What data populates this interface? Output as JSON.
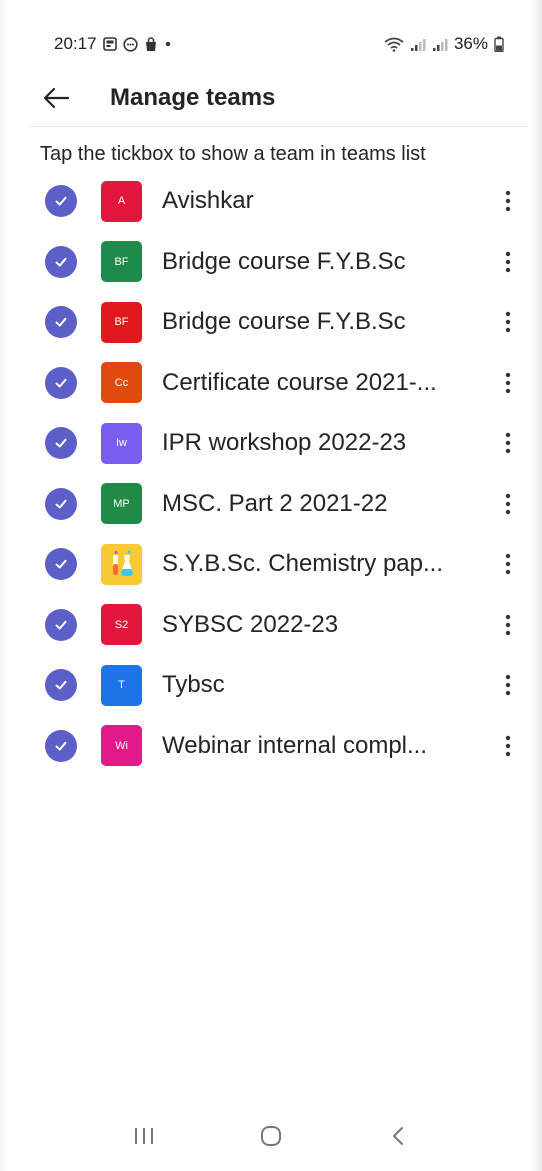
{
  "status": {
    "time": "20:17",
    "battery": "36%"
  },
  "header": {
    "title": "Manage teams"
  },
  "hint": "Tap the tickbox to show a team in teams list",
  "teams": [
    {
      "name": "Avishkar",
      "initials": "A",
      "color": "#e3173d",
      "checked": true
    },
    {
      "name": "Bridge course F.Y.B.Sc",
      "initials": "BF",
      "color": "#1e8a4b",
      "checked": true
    },
    {
      "name": "Bridge course F.Y.B.Sc",
      "initials": "BF",
      "color": "#e3171e",
      "checked": true
    },
    {
      "name": "Certificate course 2021-...",
      "initials": "Cc",
      "color": "#e04a0e",
      "checked": true
    },
    {
      "name": "IPR workshop 2022-23",
      "initials": "Iw",
      "color": "#7b5cf0",
      "checked": true
    },
    {
      "name": "MSC. Part 2 2021-22",
      "initials": "MP",
      "color": "#208a46",
      "checked": true
    },
    {
      "name": "S.Y.B.Sc. Chemistry pap...",
      "initials": "",
      "color": "#f7c935",
      "checked": true,
      "icon": "chemistry-icon"
    },
    {
      "name": "SYBSC 2022-23",
      "initials": "S2",
      "color": "#e3173d",
      "checked": true
    },
    {
      "name": "Tybsc",
      "initials": "T",
      "color": "#1c74e6",
      "checked": true
    },
    {
      "name": "Webinar internal compl...",
      "initials": "Wi",
      "color": "#e3198a",
      "checked": true
    }
  ],
  "colors": {
    "check": "#5b5fc7",
    "text": "#242424"
  }
}
